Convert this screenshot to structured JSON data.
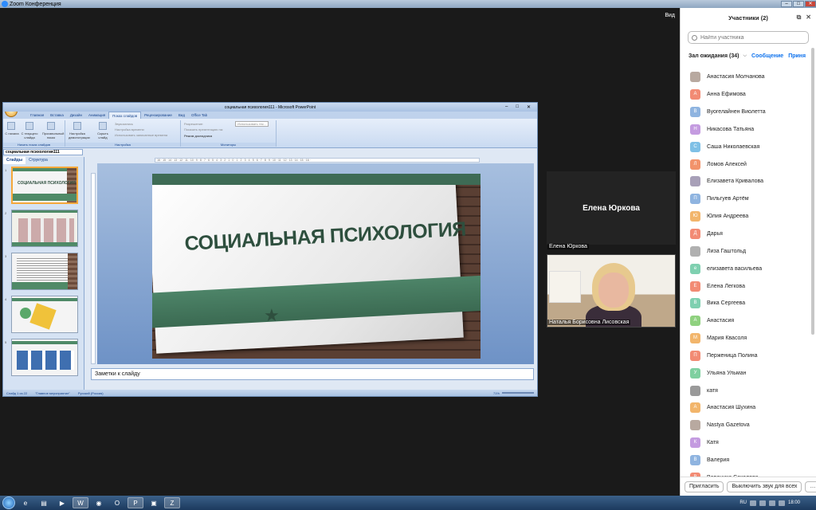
{
  "window": {
    "title": "Zoom Конференция"
  },
  "main": {
    "view_label": "Вид"
  },
  "powerpoint": {
    "title": "социальная психология111 - Microsoft PowerPoint",
    "tabs": [
      "Главная",
      "Вставка",
      "Дизайн",
      "Анимация",
      "Показ слайдов",
      "Рецензирование",
      "Вид",
      "Office Tab"
    ],
    "active_tab": "Показ слайдов",
    "ribbon": {
      "btn_start": "С начала",
      "btn_current": "С текущего слайда",
      "btn_custom": "Произвольный показ",
      "group1": "Начать показ слайдов",
      "btn_setup": "Настройка демонстрации",
      "btn_hide": "Скрыть слайд",
      "opt_record": "Звукозапись",
      "opt_timing": "Настройка времени",
      "opt_use_timing": "Использовать записанные времена",
      "group2": "Настройка",
      "opt_resolution": "Разрешение:",
      "opt_resolution_val": "Использовать тек...",
      "opt_show_on": "Показать презентацию на:",
      "opt_presenter": "Режим докладчика",
      "group3": "Мониторы"
    },
    "doc_tab": "социальная психология111",
    "pane_tabs": [
      "Слайды",
      "Структура"
    ],
    "thumb_numbers": [
      "1",
      "2",
      "3",
      "4",
      "5"
    ],
    "thumb_titles": [
      "СОЦИАЛЬНАЯ ПСИХОЛОГИЯ"
    ],
    "ruler": "· 16 · 15 · 14 · 13 · 12 · 11 · 10 · 9 · 8 · 7 · 6 · 5 · 4 · 3 · 2 · 1 · 0 · 1 · 2 · 3 · 4 · 5 · 6 · 7 · 8 · 9 · 10 · 11 · 12 · 13 · 14 · 15 · 16 ·",
    "slide_title": "СОЦИАЛЬНАЯ ПСИХОЛОГИЯ",
    "notes": "Заметки к слайду",
    "status_slide": "Слайд 1 из 22",
    "status_theme": "\"Главное мероприятие\"",
    "status_lang": "Русский (Россия)",
    "status_zoom": "71%"
  },
  "tiles": {
    "name_tile": "Елена Юркова",
    "name_tile_label": "Елена Юркова",
    "video_label": "Наталья Борисовна Лисовская"
  },
  "panel": {
    "title": "Участники (2)",
    "search_placeholder": "Найти участника",
    "waiting_label": "Зал ожидания (34)",
    "message_btn": "Сообщение",
    "admit_btn": "Приня",
    "invite_btn": "Пригласить",
    "unmute_btn": "Выключить звук для всех",
    "participants": [
      {
        "name": "Анастасия Молчанова",
        "initial": "",
        "color": "#b8a9a0"
      },
      {
        "name": "Анна Ефимова",
        "initial": "А",
        "color": "#f28b74"
      },
      {
        "name": "Вуогелайнен Виолетта",
        "initial": "В",
        "color": "#8fb4e0"
      },
      {
        "name": "Никасова Татьяна",
        "initial": "Н",
        "color": "#c49be0"
      },
      {
        "name": "Саша Николаевская",
        "initial": "С",
        "color": "#7fc0e6"
      },
      {
        "name": "Ломов Алексей",
        "initial": "Л",
        "color": "#f2936b"
      },
      {
        "name": "Елизавета Кривалова",
        "initial": "",
        "color": "#a8a0b8"
      },
      {
        "name": "Пильгуев Артём",
        "initial": "П",
        "color": "#8fb4e0"
      },
      {
        "name": "Юлия Андреева",
        "initial": "Ю",
        "color": "#f2b56b"
      },
      {
        "name": "Дарья",
        "initial": "Д",
        "color": "#f28b74"
      },
      {
        "name": "Лиза Гаштольд",
        "initial": "",
        "color": "#b0b0b0"
      },
      {
        "name": "елизавета васильева",
        "initial": "е",
        "color": "#7fd0b0"
      },
      {
        "name": "Елена Легкова",
        "initial": "Е",
        "color": "#f28b74"
      },
      {
        "name": "Вика Сергеева",
        "initial": "В",
        "color": "#7fd0b0"
      },
      {
        "name": "Анастасия",
        "initial": "А",
        "color": "#8fd17f"
      },
      {
        "name": "Мария Квасоля",
        "initial": "М",
        "color": "#f2b56b"
      },
      {
        "name": "Перженица Полина",
        "initial": "П",
        "color": "#f28b74"
      },
      {
        "name": "Ульяна Ульман",
        "initial": "У",
        "color": "#7fd0a0"
      },
      {
        "name": "катя",
        "initial": "",
        "color": "#9a9a9a"
      },
      {
        "name": "Анастасия Шухина",
        "initial": "А",
        "color": "#f2b56b"
      },
      {
        "name": "Nastya Gazetova",
        "initial": "",
        "color": "#b8a9a0"
      },
      {
        "name": "Катя",
        "initial": "К",
        "color": "#c49be0"
      },
      {
        "name": "Валерия",
        "initial": "В",
        "color": "#8fb4e0"
      },
      {
        "name": "Вероника Соколова",
        "initial": "В",
        "color": "#f28b74"
      }
    ]
  },
  "taskbar": {
    "lang": "RU",
    "time": "18:00"
  }
}
